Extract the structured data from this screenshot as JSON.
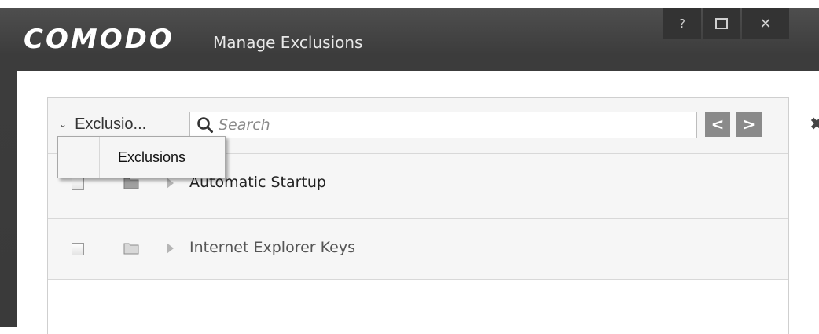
{
  "window": {
    "brand": "COMODO",
    "title": "Manage Exclusions",
    "controls": {
      "help": "?",
      "close": "✕"
    }
  },
  "toolbar": {
    "filter_label": "Exclusio...",
    "search_placeholder": "Search",
    "clear_symbol": "✖",
    "prev_symbol": "<",
    "next_symbol": ">"
  },
  "rows": [
    {
      "label": "Automatic Startup",
      "checked": false
    },
    {
      "label": "Internet Explorer Keys",
      "checked": false
    }
  ],
  "dropdown": {
    "items": [
      "Exclusions"
    ]
  },
  "colors": {
    "titlebar": "#3c3c3c",
    "accent_nav": "#8a8a8a"
  }
}
